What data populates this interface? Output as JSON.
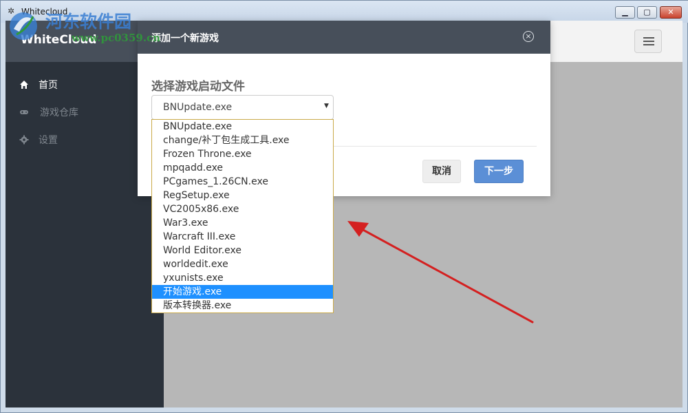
{
  "window": {
    "title": "Whitecloud",
    "controls": {
      "minimize": "▁",
      "maximize": "▢",
      "close": "✕"
    }
  },
  "watermark": {
    "text": "河东软件园",
    "url": "www.pc0359.cn"
  },
  "app": {
    "brand": "WhiteCloud"
  },
  "sidebar": {
    "items": [
      {
        "label": "首页",
        "icon": "home-icon",
        "active": true
      },
      {
        "label": "游戏仓库",
        "icon": "gamepad-icon",
        "active": false
      },
      {
        "label": "设置",
        "icon": "gear-icon",
        "active": false
      }
    ]
  },
  "modal": {
    "title": "添加一个新游戏",
    "field_label": "选择游戏启动文件",
    "selected_value": "BNUpdate.exe",
    "cancel_label": "取消",
    "next_label": "下一步"
  },
  "dropdown": {
    "options": [
      "BNUpdate.exe",
      "change/补丁包生成工具.exe",
      "Frozen Throne.exe",
      "mpqadd.exe",
      "PCgames_1.26CN.exe",
      "RegSetup.exe",
      "VC2005x86.exe",
      "War3.exe",
      "Warcraft III.exe",
      "World Editor.exe",
      "worldedit.exe",
      "yxunists.exe",
      "开始游戏.exe",
      "版本转换器.exe"
    ],
    "highlighted": "开始游戏.exe"
  },
  "colors": {
    "header_dark": "#474f5a",
    "sidebar_dark": "#2b323b",
    "primary_button": "#5b8fd6",
    "highlight": "#1e90ff",
    "annotation_arrow": "#d42020"
  }
}
